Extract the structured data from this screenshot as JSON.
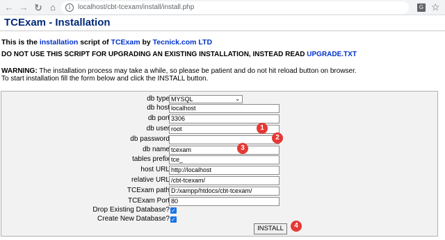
{
  "browser": {
    "back_glyph": "←",
    "forward_glyph": "→",
    "reload_glyph": "↻",
    "home_glyph": "⌂",
    "url": "localhost/cbt-tcexam/install/install.php",
    "translate_glyph": "G",
    "star_glyph": "☆"
  },
  "page": {
    "title": "TCExam - Installation",
    "intro": {
      "part1": "This is the ",
      "link1": "installation",
      "part2": " script of ",
      "link2": "TCExam",
      "part3": " by ",
      "link3": "Tecnick.com LTD"
    },
    "notice": {
      "text": "DO NOT USE THIS SCRIPT FOR UPGRADING AN EXISTING INSTALLATION, INSTEAD READ ",
      "link": "UPGRADE.TXT"
    },
    "warning": {
      "label": "WARNING:",
      "text": " The installation process may take a while, so please be patient and do not hit reload button on browser."
    },
    "instruction": "To start installation fill the form below and click the INSTALL button."
  },
  "form": {
    "db_type": {
      "label": "db type",
      "value": "MYSQL"
    },
    "db_host": {
      "label": "db host",
      "value": "localhost"
    },
    "db_port": {
      "label": "db port",
      "value": "3306"
    },
    "db_user": {
      "label": "db user",
      "value": "root"
    },
    "db_password": {
      "label": "db password",
      "value": ""
    },
    "db_name": {
      "label": "db name",
      "value": "tcexam"
    },
    "tables_prefix": {
      "label": "tables prefix",
      "value": "tce_"
    },
    "host_url": {
      "label": "host URL",
      "value": "http://localhost"
    },
    "relative_url": {
      "label": "relative URL",
      "value": "/cbt-tcexam/"
    },
    "tcexam_path": {
      "label": "TCExam path",
      "value": "D:/xampp/htdocs/cbt-tcexam/"
    },
    "tcexam_port": {
      "label": "TCExam Port",
      "value": "80"
    },
    "drop_db": {
      "label": "Drop Existing Database?",
      "checked": true,
      "glyph": "✓"
    },
    "create_db": {
      "label": "Create New Database?",
      "checked": true,
      "glyph": "✓"
    },
    "select_arrow": "⌄",
    "install_label": "INSTALL"
  },
  "annotations": [
    "1",
    "2",
    "3",
    "4"
  ],
  "colors": {
    "badge": "#e53935",
    "title": "#002a77",
    "link": "#0033cc",
    "checkbox": "#1a73e8"
  }
}
